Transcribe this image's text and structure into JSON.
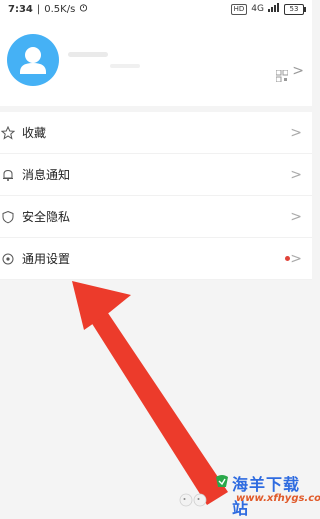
{
  "status_bar": {
    "time": "7:34",
    "speed": "0.5K/s",
    "network_badge": "HD",
    "signal": "4G",
    "battery": "53"
  },
  "profile": {
    "avatar_color": "#45b1f5"
  },
  "menu": {
    "items": [
      {
        "label": "收藏",
        "icon": "star-icon",
        "has_dot": false
      },
      {
        "label": "消息通知",
        "icon": "bell-icon",
        "has_dot": false
      },
      {
        "label": "安全隐私",
        "icon": "shield-icon",
        "has_dot": false
      },
      {
        "label": "通用设置",
        "icon": "settings-icon",
        "has_dot": true
      }
    ],
    "chevron": ">"
  },
  "watermark": {
    "title": "海羊下载站",
    "url": "www.xfhygs.com"
  },
  "colors": {
    "arrow": "#ec3b2b",
    "dot": "#e0443a",
    "accent": "#45b1f5"
  }
}
